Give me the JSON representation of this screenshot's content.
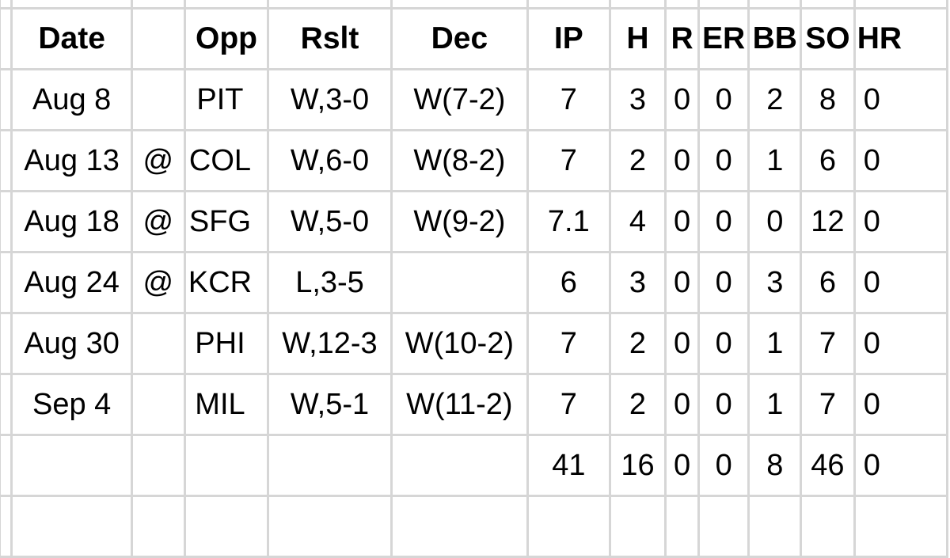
{
  "table": {
    "columns": [
      "Date",
      "",
      "Opp",
      "Rslt",
      "Dec",
      "IP",
      "H",
      "R",
      "ER",
      "BB",
      "SO",
      "HR"
    ],
    "rows": [
      {
        "date": "Aug 8",
        "at": "",
        "opp": "PIT",
        "rslt": "W,3-0",
        "dec": "W(7-2)",
        "ip": "7",
        "h": "3",
        "r": "0",
        "er": "0",
        "bb": "2",
        "so": "8",
        "hr": "0"
      },
      {
        "date": "Aug 13",
        "at": "@",
        "opp": "COL",
        "rslt": "W,6-0",
        "dec": "W(8-2)",
        "ip": "7",
        "h": "2",
        "r": "0",
        "er": "0",
        "bb": "1",
        "so": "6",
        "hr": "0"
      },
      {
        "date": "Aug 18",
        "at": "@",
        "opp": "SFG",
        "rslt": "W,5-0",
        "dec": "W(9-2)",
        "ip": "7.1",
        "h": "4",
        "r": "0",
        "er": "0",
        "bb": "0",
        "so": "12",
        "hr": "0"
      },
      {
        "date": "Aug 24",
        "at": "@",
        "opp": "KCR",
        "rslt": "L,3-5",
        "dec": "",
        "ip": "6",
        "h": "3",
        "r": "0",
        "er": "0",
        "bb": "3",
        "so": "6",
        "hr": "0"
      },
      {
        "date": "Aug 30",
        "at": "",
        "opp": "PHI",
        "rslt": "W,12-3",
        "dec": "W(10-2)",
        "ip": "7",
        "h": "2",
        "r": "0",
        "er": "0",
        "bb": "1",
        "so": "7",
        "hr": "0"
      },
      {
        "date": "Sep 4",
        "at": "",
        "opp": "MIL",
        "rslt": "W,5-1",
        "dec": "W(11-2)",
        "ip": "7",
        "h": "2",
        "r": "0",
        "er": "0",
        "bb": "1",
        "so": "7",
        "hr": "0"
      }
    ],
    "totals": {
      "ip": "41",
      "h": "16",
      "r": "0",
      "er": "0",
      "bb": "8",
      "so": "46",
      "hr": "0"
    }
  }
}
